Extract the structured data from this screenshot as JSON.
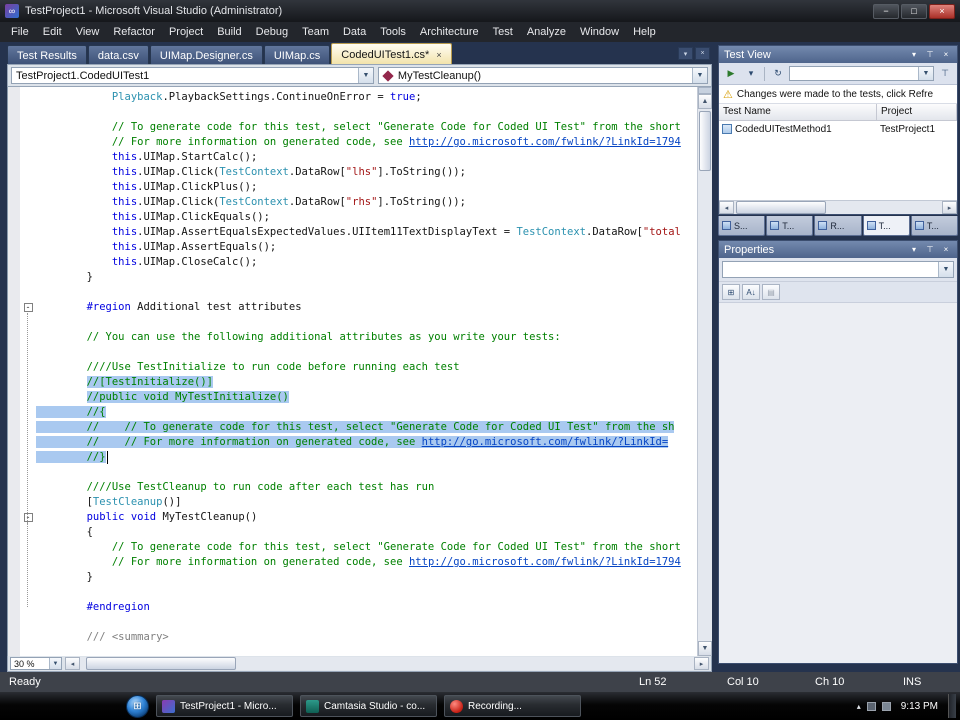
{
  "window": {
    "title": "TestProject1 - Microsoft Visual Studio (Administrator)"
  },
  "menu": {
    "items": [
      "File",
      "Edit",
      "View",
      "Refactor",
      "Project",
      "Build",
      "Debug",
      "Team",
      "Data",
      "Tools",
      "Architecture",
      "Test",
      "Analyze",
      "Window",
      "Help"
    ]
  },
  "tabs": {
    "items": [
      {
        "label": "Test Results",
        "active": false
      },
      {
        "label": "data.csv",
        "active": false
      },
      {
        "label": "UIMap.Designer.cs",
        "active": false
      },
      {
        "label": "UIMap.cs",
        "active": false
      },
      {
        "label": "CodedUITest1.cs*",
        "active": true,
        "closable": true
      }
    ]
  },
  "navbar": {
    "type_dropdown": "TestProject1.CodedUITest1",
    "member_dropdown": "MyTestCleanup()"
  },
  "editor": {
    "zoom": "30 %",
    "lines": [
      {
        "seg": [
          {
            "t": "            ",
            "c": "p"
          },
          {
            "t": "Playback",
            "c": "t"
          },
          {
            "t": ".PlaybackSettings.ContinueOnError = ",
            "c": "p"
          },
          {
            "t": "true",
            "c": "k"
          },
          {
            "t": ";",
            "c": "p"
          }
        ]
      },
      {
        "seg": []
      },
      {
        "seg": [
          {
            "t": "            ",
            "c": "p"
          },
          {
            "t": "// To generate code for this test, select \"Generate Code for Coded UI Test\" from the short",
            "c": "c"
          }
        ]
      },
      {
        "seg": [
          {
            "t": "            ",
            "c": "p"
          },
          {
            "t": "// For more information on generated code, see ",
            "c": "c"
          },
          {
            "t": "http://go.microsoft.com/fwlink/?LinkId=1794",
            "c": "l"
          }
        ]
      },
      {
        "seg": [
          {
            "t": "            ",
            "c": "p"
          },
          {
            "t": "this",
            "c": "k"
          },
          {
            "t": ".UIMap.StartCalc();",
            "c": "p"
          }
        ]
      },
      {
        "seg": [
          {
            "t": "            ",
            "c": "p"
          },
          {
            "t": "this",
            "c": "k"
          },
          {
            "t": ".UIMap.Click(",
            "c": "p"
          },
          {
            "t": "TestContext",
            "c": "t"
          },
          {
            "t": ".DataRow[",
            "c": "p"
          },
          {
            "t": "\"lhs\"",
            "c": "s"
          },
          {
            "t": "].ToString());",
            "c": "p"
          }
        ]
      },
      {
        "seg": [
          {
            "t": "            ",
            "c": "p"
          },
          {
            "t": "this",
            "c": "k"
          },
          {
            "t": ".UIMap.ClickPlus();",
            "c": "p"
          }
        ]
      },
      {
        "seg": [
          {
            "t": "            ",
            "c": "p"
          },
          {
            "t": "this",
            "c": "k"
          },
          {
            "t": ".UIMap.Click(",
            "c": "p"
          },
          {
            "t": "TestContext",
            "c": "t"
          },
          {
            "t": ".DataRow[",
            "c": "p"
          },
          {
            "t": "\"rhs\"",
            "c": "s"
          },
          {
            "t": "].ToString());",
            "c": "p"
          }
        ]
      },
      {
        "seg": [
          {
            "t": "            ",
            "c": "p"
          },
          {
            "t": "this",
            "c": "k"
          },
          {
            "t": ".UIMap.ClickEquals();",
            "c": "p"
          }
        ]
      },
      {
        "seg": [
          {
            "t": "            ",
            "c": "p"
          },
          {
            "t": "this",
            "c": "k"
          },
          {
            "t": ".UIMap.AssertEqualsExpectedValues.UIItem11TextDisplayText = ",
            "c": "p"
          },
          {
            "t": "TestContext",
            "c": "t"
          },
          {
            "t": ".DataRow[",
            "c": "p"
          },
          {
            "t": "\"total",
            "c": "s"
          }
        ]
      },
      {
        "seg": [
          {
            "t": "            ",
            "c": "p"
          },
          {
            "t": "this",
            "c": "k"
          },
          {
            "t": ".UIMap.AssertEquals();",
            "c": "p"
          }
        ]
      },
      {
        "seg": [
          {
            "t": "            ",
            "c": "p"
          },
          {
            "t": "this",
            "c": "k"
          },
          {
            "t": ".UIMap.CloseCalc();",
            "c": "p"
          }
        ]
      },
      {
        "seg": [
          {
            "t": "        }",
            "c": "p"
          }
        ]
      },
      {
        "seg": []
      },
      {
        "m": "minus",
        "seg": [
          {
            "t": "        ",
            "c": "p"
          },
          {
            "t": "#region",
            "c": "k"
          },
          {
            "t": " Additional test attributes",
            "c": "p"
          }
        ]
      },
      {
        "seg": []
      },
      {
        "seg": [
          {
            "t": "        ",
            "c": "p"
          },
          {
            "t": "// You can use the following additional attributes as you write your tests:",
            "c": "c"
          }
        ]
      },
      {
        "seg": []
      },
      {
        "seg": [
          {
            "t": "        ",
            "c": "p"
          },
          {
            "t": "////Use TestInitialize to run code before running each test",
            "c": "c"
          }
        ]
      },
      {
        "seg": [
          {
            "t": "        ",
            "c": "p"
          },
          {
            "t": "//[TestInitialize()]",
            "c": "c",
            "h": 1
          }
        ]
      },
      {
        "seg": [
          {
            "t": "        ",
            "c": "p"
          },
          {
            "t": "//public void MyTestInitialize()",
            "c": "c",
            "h": 1
          }
        ]
      },
      {
        "seg": [
          {
            "t": "        ",
            "c": "p",
            "h": 1
          },
          {
            "t": "//{",
            "c": "c",
            "h": 1
          }
        ]
      },
      {
        "seg": [
          {
            "t": "        ",
            "c": "p",
            "h": 1
          },
          {
            "t": "//    // To generate code for this test, select \"Generate Code for Coded UI Test\" from the sh",
            "c": "c",
            "h": 1
          }
        ]
      },
      {
        "seg": [
          {
            "t": "        ",
            "c": "p",
            "h": 1
          },
          {
            "t": "//    // For more information on generated code, see ",
            "c": "c",
            "h": 1
          },
          {
            "t": "http://go.microsoft.com/fwlink/?LinkId=",
            "c": "l",
            "h": 1
          }
        ]
      },
      {
        "caret": true,
        "seg": [
          {
            "t": "        ",
            "c": "p",
            "h": 1
          },
          {
            "t": "//}",
            "c": "c",
            "h": 1
          }
        ]
      },
      {
        "seg": []
      },
      {
        "seg": [
          {
            "t": "        ",
            "c": "p"
          },
          {
            "t": "////Use TestCleanup to run code after each test has run",
            "c": "c"
          }
        ]
      },
      {
        "seg": [
          {
            "t": "        [",
            "c": "p"
          },
          {
            "t": "TestCleanup",
            "c": "t"
          },
          {
            "t": "()]",
            "c": "p"
          }
        ]
      },
      {
        "m": "minus",
        "seg": [
          {
            "t": "        ",
            "c": "p"
          },
          {
            "t": "public",
            "c": "k"
          },
          {
            "t": " ",
            "c": "p"
          },
          {
            "t": "void",
            "c": "k"
          },
          {
            "t": " MyTestCleanup()",
            "c": "p"
          }
        ]
      },
      {
        "seg": [
          {
            "t": "        {",
            "c": "p"
          }
        ]
      },
      {
        "seg": [
          {
            "t": "            ",
            "c": "p"
          },
          {
            "t": "// To generate code for this test, select \"Generate Code for Coded UI Test\" from the short",
            "c": "c"
          }
        ]
      },
      {
        "seg": [
          {
            "t": "            ",
            "c": "p"
          },
          {
            "t": "// For more information on generated code, see ",
            "c": "c"
          },
          {
            "t": "http://go.microsoft.com/fwlink/?LinkId=1794",
            "c": "l"
          }
        ]
      },
      {
        "seg": [
          {
            "t": "        }",
            "c": "p"
          }
        ]
      },
      {
        "seg": []
      },
      {
        "seg": [
          {
            "t": "        ",
            "c": "p"
          },
          {
            "t": "#endregion",
            "c": "k"
          }
        ]
      },
      {
        "seg": []
      },
      {
        "seg": [
          {
            "t": "        ",
            "c": "p"
          },
          {
            "t": "/// <summary>",
            "c": "d"
          }
        ]
      }
    ]
  },
  "test_view": {
    "title": "Test View",
    "warning": "Changes were made to the tests, click Refre",
    "columns": [
      "Test Name",
      "Project"
    ],
    "rows": [
      {
        "name": "CodedUITestMethod1",
        "project": "TestProject1"
      }
    ],
    "panel_tabs": [
      {
        "label": "S...",
        "active": false
      },
      {
        "label": "T...",
        "active": false
      },
      {
        "label": "R...",
        "active": false
      },
      {
        "label": "T...",
        "active": true
      },
      {
        "label": "T...",
        "active": false
      }
    ]
  },
  "properties": {
    "title": "Properties"
  },
  "status_bar": {
    "ready": "Ready",
    "ln": "Ln 52",
    "col": "Col 10",
    "ch": "Ch 10",
    "ins": "INS"
  },
  "taskbar": {
    "buttons": [
      {
        "label": "TestProject1 - Micro...",
        "icon": "visual-studio"
      },
      {
        "label": "Camtasia Studio - co...",
        "icon": "camtasia"
      },
      {
        "label": "Recording...",
        "icon": "recording"
      }
    ],
    "clock": "9:13 PM"
  },
  "colors": {
    "active_tab": "#f2e3ab",
    "selection": "#a9c9f0",
    "keyword": "#0000e0",
    "comment": "#008000",
    "string": "#a31515",
    "type": "#2b91af"
  }
}
